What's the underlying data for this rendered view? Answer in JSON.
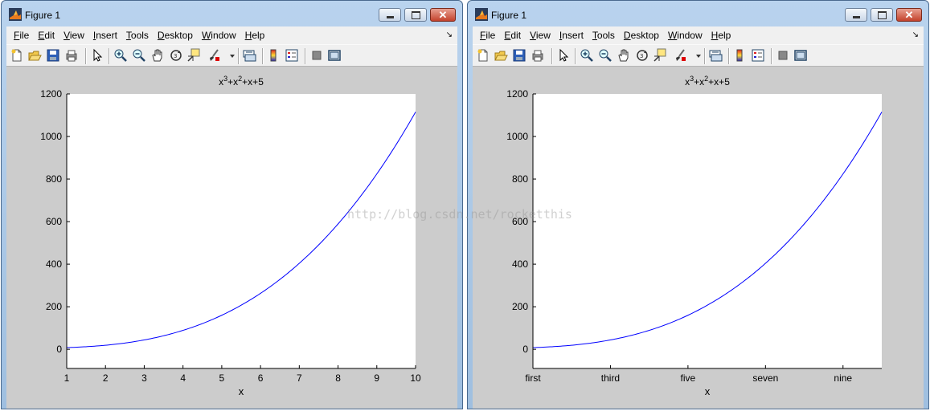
{
  "windows": [
    {
      "title": "Figure 1",
      "menu": [
        "File",
        "Edit",
        "View",
        "Insert",
        "Tools",
        "Desktop",
        "Window",
        "Help"
      ],
      "menu_underline": [
        "F",
        "E",
        "V",
        "I",
        "T",
        "D",
        "W",
        "H"
      ],
      "chart_data": {
        "type": "line",
        "title": "x³+x²+x+5",
        "title_parts": {
          "t1": "x",
          "s1": "3",
          "t2": "+x",
          "s2": "2",
          "t3": "+x+5"
        },
        "xlabel": "x",
        "ylabel": "",
        "xlim": [
          1,
          10
        ],
        "ylim": [
          -90,
          1200
        ],
        "xticks": [
          1,
          2,
          3,
          4,
          5,
          6,
          7,
          8,
          9,
          10
        ],
        "xtick_labels": [
          "1",
          "2",
          "3",
          "4",
          "5",
          "6",
          "7",
          "8",
          "9",
          "10"
        ],
        "yticks": [
          0,
          200,
          400,
          600,
          800,
          1000,
          1200
        ],
        "ytick_labels": [
          "0",
          "200",
          "400",
          "600",
          "800",
          "1000",
          "1200"
        ],
        "series": [
          {
            "function": "x^3+x^2+x+5",
            "x_range": [
              1,
              10
            ],
            "color": "#0000ff"
          }
        ],
        "grid": false
      }
    },
    {
      "title": "Figure 1",
      "menu": [
        "File",
        "Edit",
        "View",
        "Insert",
        "Tools",
        "Desktop",
        "Window",
        "Help"
      ],
      "menu_underline": [
        "F",
        "E",
        "V",
        "I",
        "T",
        "D",
        "W",
        "H"
      ],
      "chart_data": {
        "type": "line",
        "title": "x³+x²+x+5",
        "title_parts": {
          "t1": "x",
          "s1": "3",
          "t2": "+x",
          "s2": "2",
          "t3": "+x+5"
        },
        "xlabel": "x",
        "ylabel": "",
        "xlim": [
          1,
          10
        ],
        "ylim": [
          -90,
          1200
        ],
        "xticks": [
          1,
          3,
          5,
          7,
          9
        ],
        "xtick_labels": [
          "first",
          "third",
          "five",
          "seven",
          "nine"
        ],
        "yticks": [
          0,
          200,
          400,
          600,
          800,
          1000,
          1200
        ],
        "ytick_labels": [
          "0",
          "200",
          "400",
          "600",
          "800",
          "1000",
          "1200"
        ],
        "series": [
          {
            "function": "x^3+x^2+x+5",
            "x_range": [
              1,
              10
            ],
            "color": "#0000ff"
          }
        ],
        "grid": false
      }
    }
  ],
  "watermark": "http://blog.csdn.net/rocketthis",
  "colors": {
    "plot_line": "#0000ff",
    "figure_bg": "#cccccc",
    "axes_bg": "#ffffff"
  }
}
